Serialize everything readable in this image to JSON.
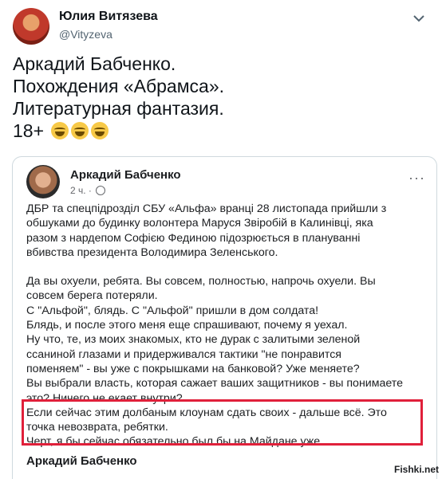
{
  "tweet": {
    "author_name": "Юлия Витязева",
    "handle": "@Vityzeva",
    "lines": [
      "Аркадий Бабченко.",
      "Похождения «Абрамса».",
      "Литературная фантазия.",
      "18+"
    ],
    "emoji_count": 3,
    "menu_icon": "chevron-down-icon"
  },
  "embedded_post": {
    "author_name": "Аркадий Бабченко",
    "timestamp": "2 ч.",
    "privacy_icon": "globe-icon",
    "menu": "···",
    "paragraph1": [
      "ДБР та  спецпідрозділ СБУ «Альфа» вранці 28 листопада прийшли з",
      "обшуками до будинку волонтера Маруся Звіробій  в Калинівці, яка",
      "разом з нардепом Софією Фединою підозрюється в плануванні",
      "вбивства президента Володимира Зеленського."
    ],
    "paragraph2": [
      "Да вы охуели, ребята. Вы совсем, полностью, напрочь охуели. Вы",
      "совсем берега потеряли.",
      "С \"Альфой\", блядь. С \"Альфой\" пришли в дом солдата!",
      "Блядь, и после этого меня еще спрашивают, почему я уехал.",
      "Ну что, те, из моих знакомых, кто не дурак с залитыми зеленой",
      "ссаниной глазами и придерживался тактики \"не понравится",
      "поменяем\" - вы уже с покрышками на банковой? Уже меняете?",
      "Вы выбрали власть, которая сажает ваших защитников - вы понимаете",
      "это? Ничего не екает внутри?",
      "Если сейчас этим долбаным клоунам сдать своих - дальше всё. Это",
      "точка невозврата, ребятки.",
      "Черт, я бы сейчас обязательно был бы на Майдане уже."
    ],
    "footer_name": "Аркадий Бабченко"
  },
  "watermark": "Fishki.net"
}
